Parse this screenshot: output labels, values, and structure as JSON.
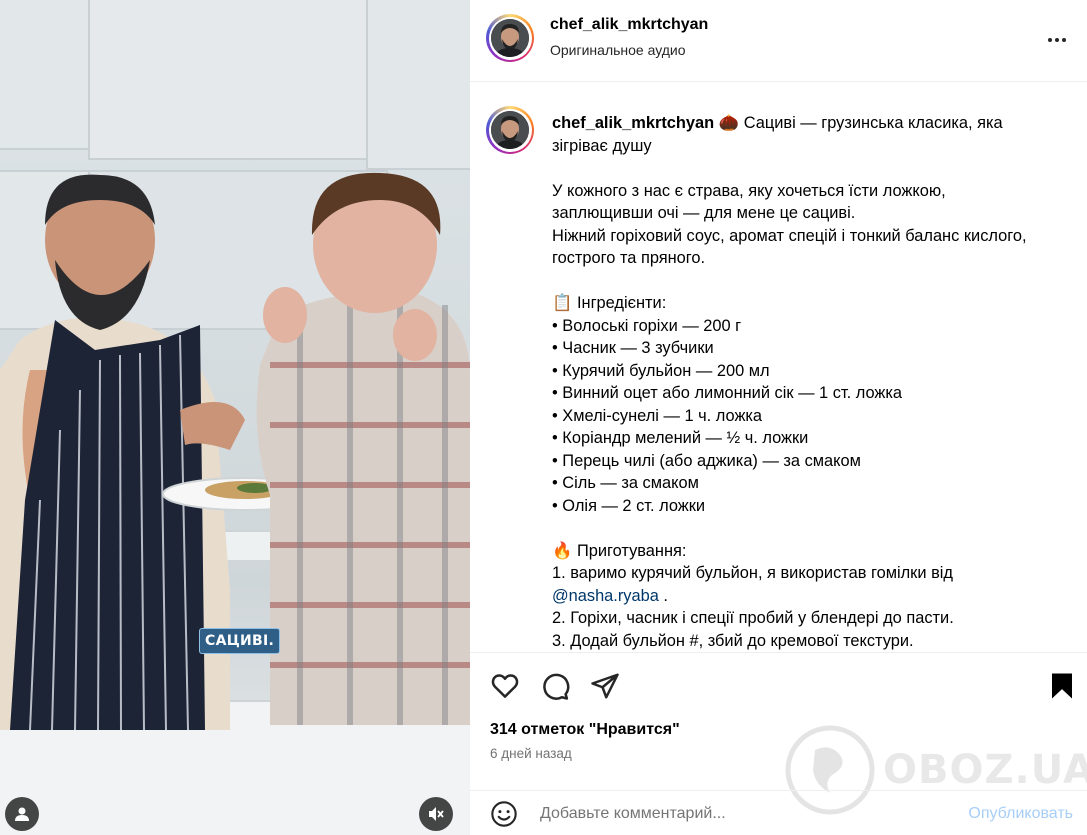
{
  "video": {
    "subtitle": "САЦИВІ."
  },
  "header": {
    "username": "chef_alik_mkrtchyan",
    "audio": "Оригинальное аудио"
  },
  "caption": {
    "username": "chef_alik_mkrtchyan",
    "lines": [
      "Сациві — грузинська класика, яка",
      "зігріває душу",
      "",
      "У кожного з нас є страва, яку хочеться їсти ложкою,",
      "заплющивши очі — для мене це сациві.",
      "Ніжний горіховий соус, аромат спецій і тонкий баланс кислого,",
      "гострого та пряного.",
      "",
      "📋 Інгредієнти:",
      "• Волоські горіхи — 200 г",
      "• Часник — 3 зубчики",
      "• Курячий бульйон — 200 мл",
      "• Винний оцет або лимонний сік — 1 ст. ложка",
      "• Хмелі-сунелі — 1 ч. ложка",
      "• Коріандр мелений — ½ ч. ложки",
      "• Перець чилі (або аджика) — за смаком",
      "• Сіль — за смаком",
      "• Олія — 2 ст. ложки",
      "",
      "🔥 Приготування:",
      "1. варимо курячий бульйон, я використав гомілки від",
      "2. Горіхи, часник і спеції пробий у блендері до пасти.",
      "3. Додай бульйон #, збий до кремової текстури."
    ],
    "mention": "@nasha.ryaba",
    "mention_suffix": " ."
  },
  "likes": "314 отметок \"Нравится\"",
  "date": "6 дней назад",
  "comment": {
    "placeholder": "Добавьте комментарий...",
    "publish": "Опубликовать"
  },
  "watermark": "OBOZ.UA",
  "icons": {
    "like": "heart-icon",
    "comment": "comment-icon",
    "share": "share-icon",
    "save": "bookmark-icon",
    "emoji": "emoji-icon",
    "more": "more-icon"
  },
  "colors": {
    "publish": "#a8cef7",
    "mention": "#00376b",
    "muted": "#737373"
  }
}
